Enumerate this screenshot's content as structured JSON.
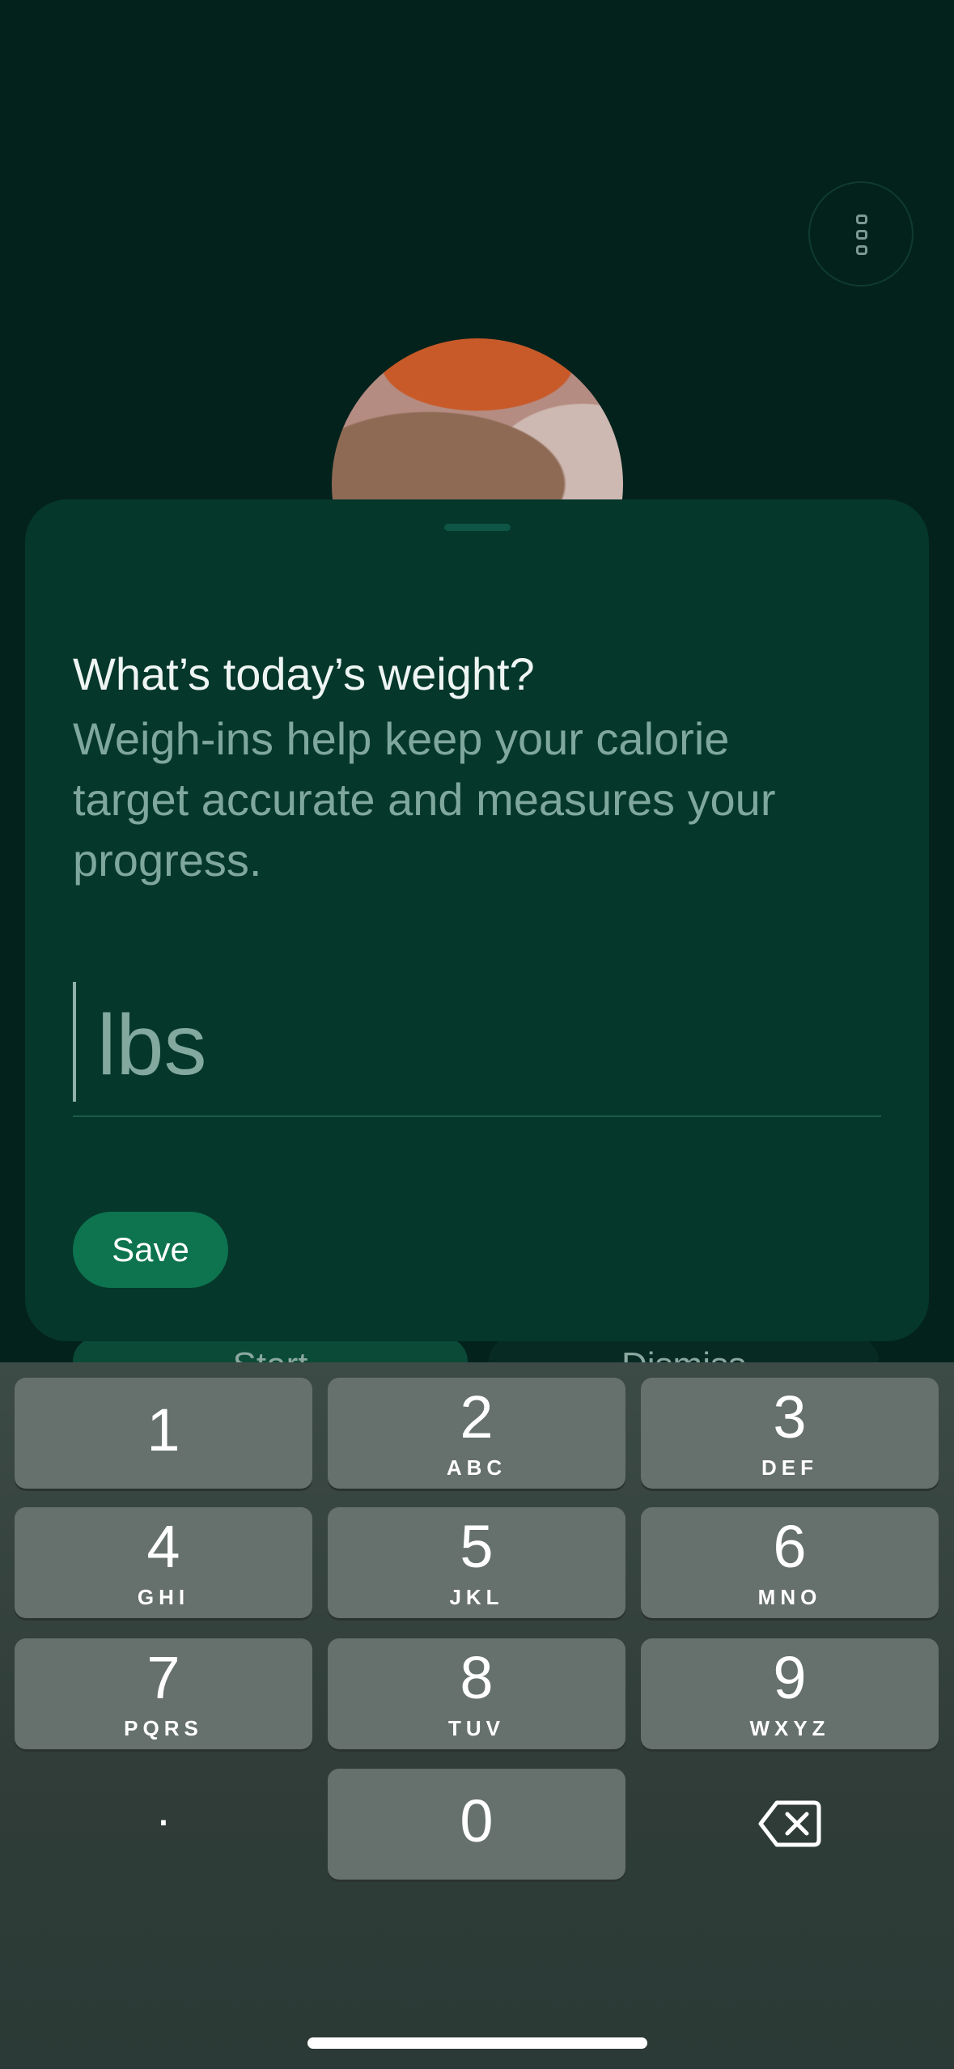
{
  "sheet": {
    "title": "What’s today’s weight?",
    "subtitle": "Weigh-ins help keep your calorie target accurate and measures your progress.",
    "weight_placeholder": "lbs",
    "save_label": "Save"
  },
  "background_buttons": {
    "start_label": "Start",
    "dismiss_label": "Dismiss"
  },
  "keyboard": {
    "keys": [
      {
        "digit": "1",
        "letters": ""
      },
      {
        "digit": "2",
        "letters": "ABC"
      },
      {
        "digit": "3",
        "letters": "DEF"
      },
      {
        "digit": "4",
        "letters": "GHI"
      },
      {
        "digit": "5",
        "letters": "JKL"
      },
      {
        "digit": "6",
        "letters": "MNO"
      },
      {
        "digit": "7",
        "letters": "PQRS"
      },
      {
        "digit": "8",
        "letters": "TUV"
      },
      {
        "digit": "9",
        "letters": "WXYZ"
      },
      {
        "digit": "0",
        "letters": ""
      }
    ],
    "decimal": "."
  },
  "colors": {
    "background": "#04221c",
    "sheet": "#05372b",
    "save_button": "#0d744f",
    "key": "#66706d"
  },
  "icons": [
    "more-vertical-icon",
    "backspace-icon"
  ]
}
